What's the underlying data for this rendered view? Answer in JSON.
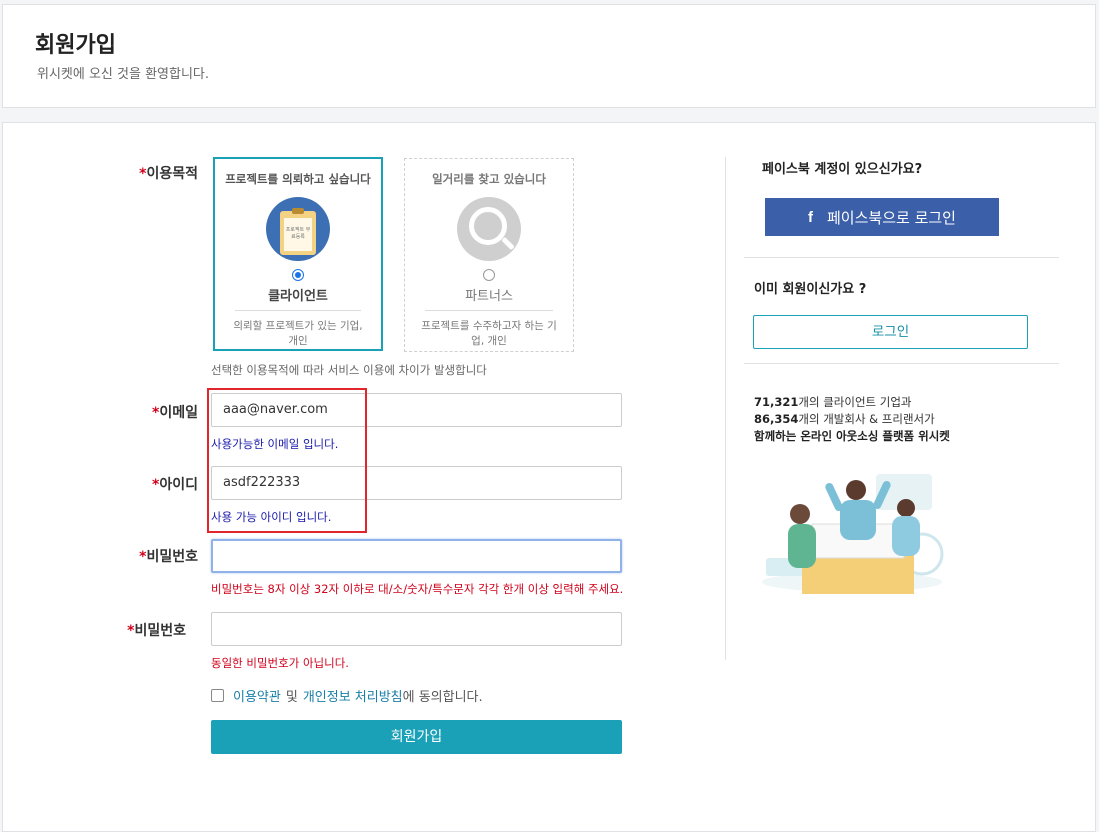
{
  "header": {
    "title": "회원가입",
    "subtitle": "위시켓에 오신 것을 환영합니다."
  },
  "form": {
    "purpose": {
      "label": "이용목적",
      "client": {
        "title": "프로젝트를 의뢰하고 싶습니다",
        "illus_text": "프로젝트 무료등록",
        "role": "클라이언트",
        "desc": "의뢰할 프로젝트가 있는 기업, 개인",
        "selected": true
      },
      "partner": {
        "title": "일거리를 찾고 있습니다",
        "role": "파트너스",
        "desc": "프로젝트를 수주하고자 하는 기업, 개인",
        "selected": false
      },
      "note": "선택한 이용목적에 따라 서비스 이용에 차이가 발생합니다"
    },
    "email": {
      "label": "이메일",
      "value": "aaa@naver.com",
      "message": "사용가능한 이메일 입니다."
    },
    "userid": {
      "label": "아이디",
      "value": "asdf222333",
      "message": "사용 가능 아이디 입니다."
    },
    "password": {
      "label": "비밀번호",
      "value": "",
      "message": "비밀번호는 8자 이상 32자 이하로 대/소/숫자/특수문자 각각 한개 이상 입력해 주세요."
    },
    "password_confirm": {
      "label": "비밀번호",
      "value": "",
      "message": "동일한 비밀번호가 아닙니다."
    },
    "agree": {
      "terms_link": "이용약관",
      "and": "및",
      "privacy_link": "개인정보 처리방침",
      "suffix": "에 동의합니다.",
      "checked": false
    },
    "submit_label": "회원가입"
  },
  "side": {
    "facebook_question": "페이스북 계정이 있으신가요?",
    "facebook_button": "페이스북으로 로그인",
    "member_question": "이미 회원이신가요 ?",
    "login_button": "로그인",
    "stats": {
      "client_count": "71,321",
      "client_text": "개의 클라이언트 기업과",
      "dev_count": "86,354",
      "dev_text": "개의 개발회사 & 프리랜서가",
      "tagline": "함께하는 온라인 아웃소싱 플랫폼 위시켓"
    }
  },
  "colors": {
    "accent": "#1aa1b8",
    "facebook": "#3b5fa8",
    "error": "#d0021b",
    "success": "#1a1aaa",
    "highlight": "#e0262a"
  }
}
